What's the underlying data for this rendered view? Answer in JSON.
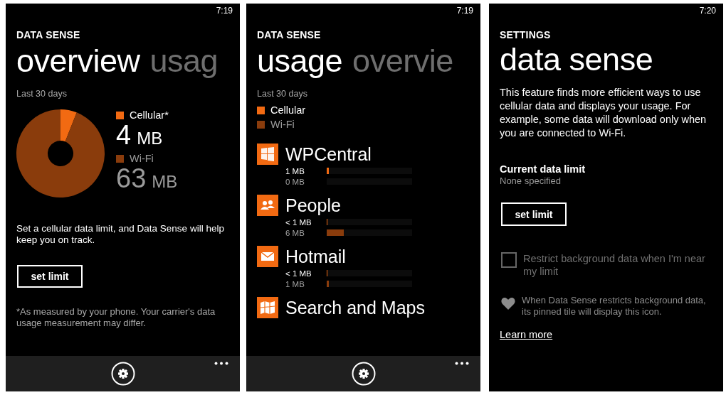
{
  "overview_screen": {
    "time": "7:19",
    "app_title": "DATA SENSE",
    "pivots": [
      {
        "label": "overview",
        "selected": true
      },
      {
        "label": "usag",
        "selected": false
      }
    ],
    "period": "Last 30 days",
    "legend": [
      {
        "value": "4",
        "unit": "MB",
        "color": "#f26a12",
        "highlighted": true
      },
      {
        "value": "63",
        "unit": "MB",
        "color": "#8a3c0c",
        "highlighted": false
      }
    ],
    "chart_data": {
      "type": "donut",
      "categories": [
        "Cellular*",
        "Wi-Fi"
      ],
      "series": [
        {
          "values": [
            6,
            94
          ]
        }
      ]
    },
    "message": "Set a cellular data limit, and Data Sense will help keep you on track.",
    "button": "set limit",
    "footnote": "*As measured by your phone. Your carrier's data usage measurement may differ."
  },
  "usage_screen": {
    "time": "7:19",
    "app_title": "DATA SENSE",
    "pivots": [
      {
        "label": "usage",
        "selected": true
      },
      {
        "label": "overvie",
        "selected": false
      }
    ],
    "period": "Last 30 days",
    "legend": [
      {
        "label": "Cellular",
        "color": "#f26a12",
        "highlighted": true
      },
      {
        "label": "Wi-Fi",
        "color": "#8a3c0c",
        "highlighted": false
      }
    ],
    "apps": [
      {
        "name": "WPCentral",
        "kind": "windows",
        "rows": [
          {
            "kind": "cellular",
            "reading": "1 MB",
            "level": 0.025
          },
          {
            "kind": "wifi",
            "reading": "0 MB"
          }
        ]
      },
      {
        "name": "People",
        "kind": "people",
        "rows": [
          {
            "kind": "cellular",
            "reading": "< 1 MB",
            "level": 0.01
          },
          {
            "kind": "wifi",
            "reading": "6 MB",
            "level": 0.2
          }
        ]
      },
      {
        "name": "Hotmail",
        "kind": "mail",
        "rows": [
          {
            "kind": "cellular",
            "reading": "< 1 MB",
            "level": 0.01
          },
          {
            "kind": "wifi",
            "reading": "1 MB",
            "level": 0.025
          }
        ]
      },
      {
        "name": "Search and Maps",
        "kind": "map"
      }
    ]
  },
  "settings_screen": {
    "time": "7:20",
    "app_title": "SETTINGS",
    "page_title": "data sense",
    "description": "This feature finds more efficient ways to use cellular data and displays your usage. For example, some data will download only when you are connected to Wi-Fi.",
    "limit_label": "Current data limit",
    "limit_value": "None specified",
    "button": "set limit",
    "checkbox": {
      "label": "Restrict background data when I'm near my limit",
      "checked": false,
      "disabled": true
    },
    "note": "When Data Sense restricts background data, its pinned tile will display this icon.",
    "link": "Learn more"
  }
}
